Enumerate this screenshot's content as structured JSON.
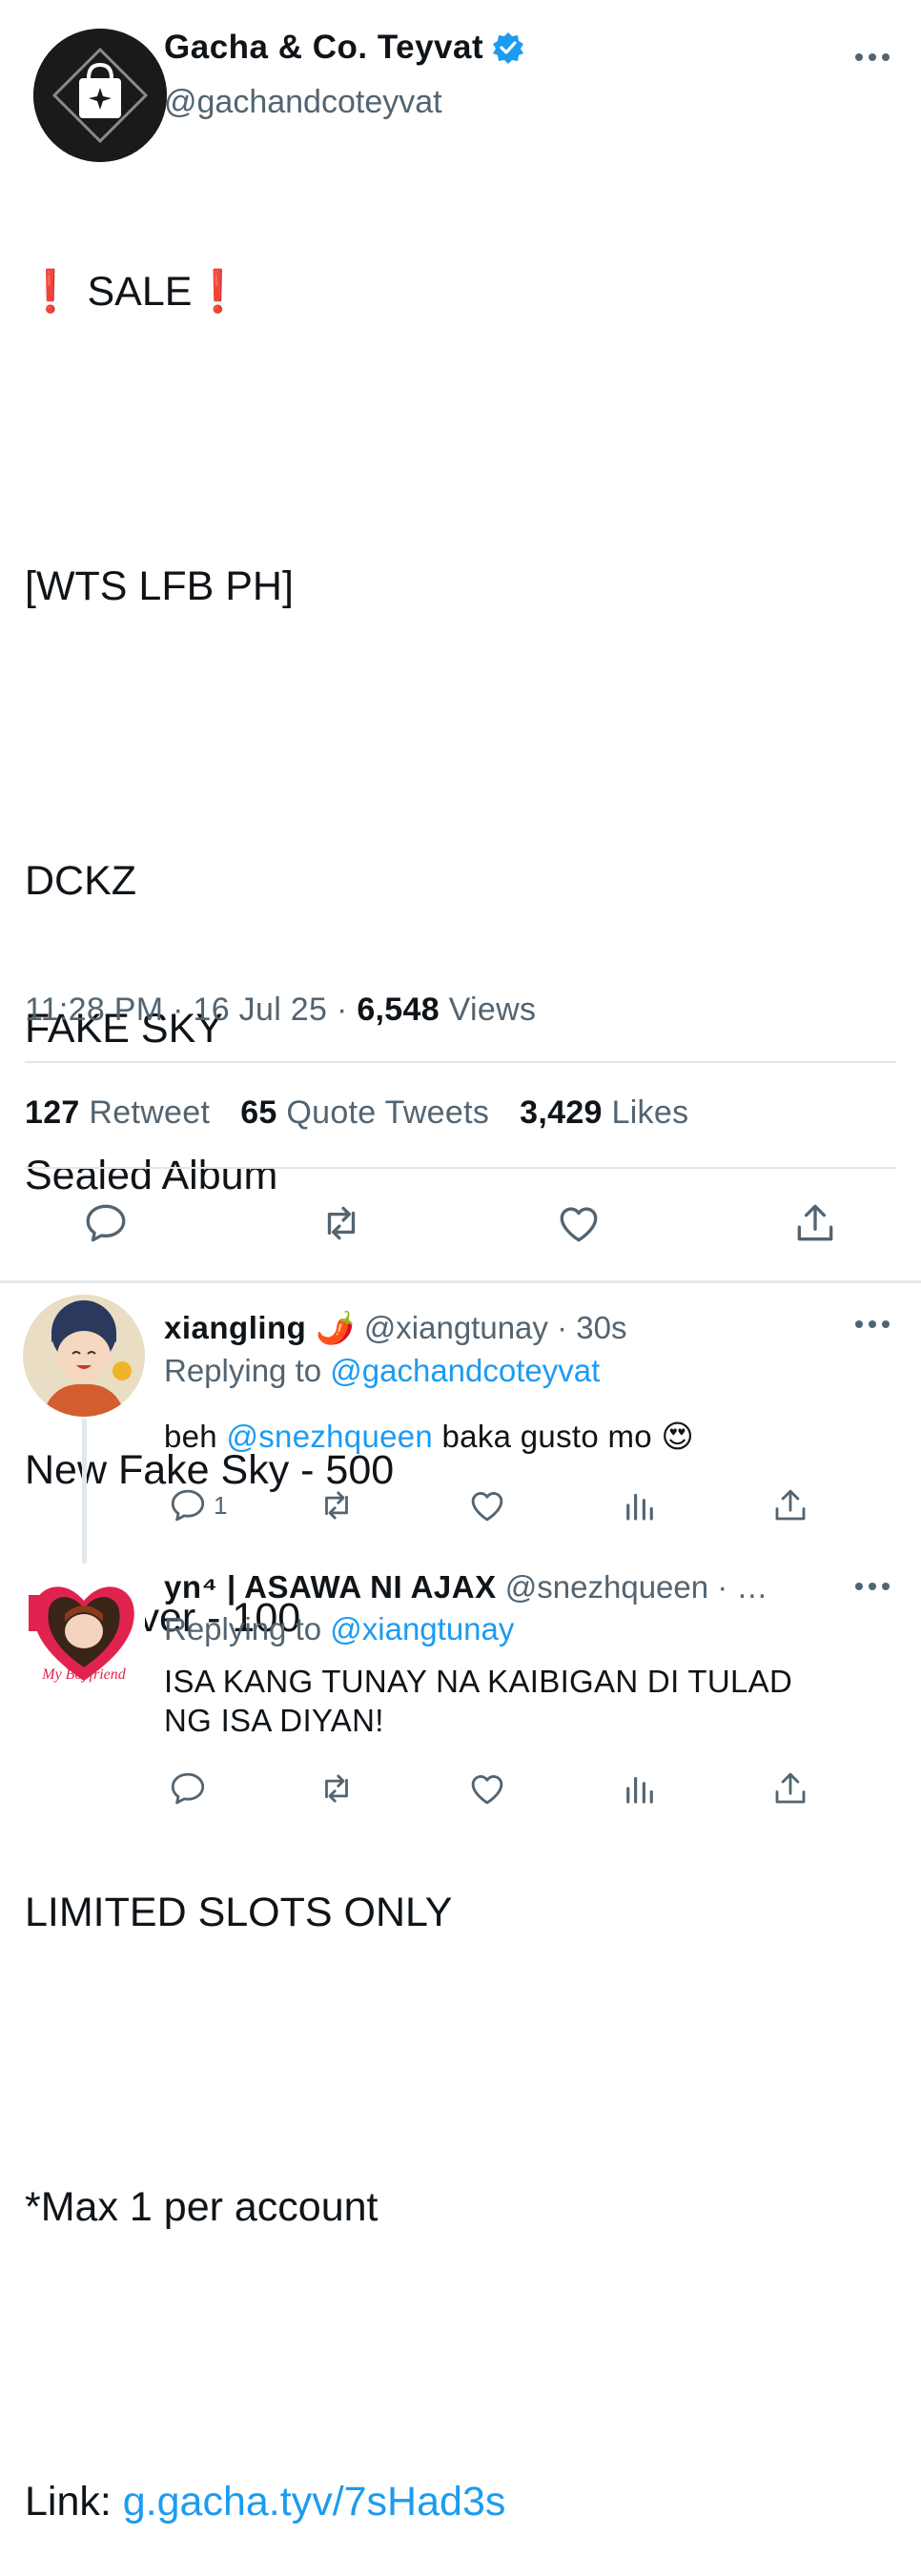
{
  "tweet": {
    "author_name": "Gacha & Co. Teyvat",
    "author_handle": "@gachandcoteyvat",
    "verified": true,
    "more_icon": "more-icon",
    "lines": [
      "❗ SALE❗",
      "",
      "[WTS LFB PH]",
      "",
      "DCKZ",
      "FAKE SKY",
      "Sealed Album",
      "",
      "New Fake Sky - 500",
      "Other ver - 100",
      "",
      "LIMITED SLOTS ONLY",
      "",
      "*Max 1 per account",
      ""
    ],
    "link_prefix": "Link: ",
    "link_text": "g.gacha.tyv/7sHad3s",
    "time": "11:28 PM · 16 Jul 25 · ",
    "views_count": "6,548",
    "views_label": " Views",
    "retweets_count": "127",
    "retweets_label": " Retweet",
    "quotes_count": "65",
    "quotes_label": " Quote Tweets",
    "likes_count": "3,429",
    "likes_label": " Likes",
    "actions": [
      "reply-icon",
      "retweet-icon",
      "like-icon",
      "share-icon"
    ]
  },
  "replies": [
    {
      "name": "xiangling 🌶️",
      "handle": "@xiangtunay",
      "time": " · 30s",
      "replying_prefix": "Replying to ",
      "replying_to": "@gachandcoteyvat",
      "text_pre": "beh ",
      "mention": "@snezhqueen",
      "text_post": " baka gusto mo 😍",
      "reply_count": "1"
    },
    {
      "name": "yn⁴ | ASAWA NI AJAX",
      "handle": "@snezhqueen · …",
      "replying_prefix": "Replying to ",
      "replying_to": "@xiangtunay",
      "text_line1": "ISA KANG TUNAY NA KAIBIGAN DI TULAD",
      "text_line2": "NG ISA DIYAN!",
      "avatar_text": "My Boyfriend"
    }
  ],
  "colors": {
    "accent": "#1d9bf0",
    "text": "#0f1419",
    "muted": "#536471"
  }
}
